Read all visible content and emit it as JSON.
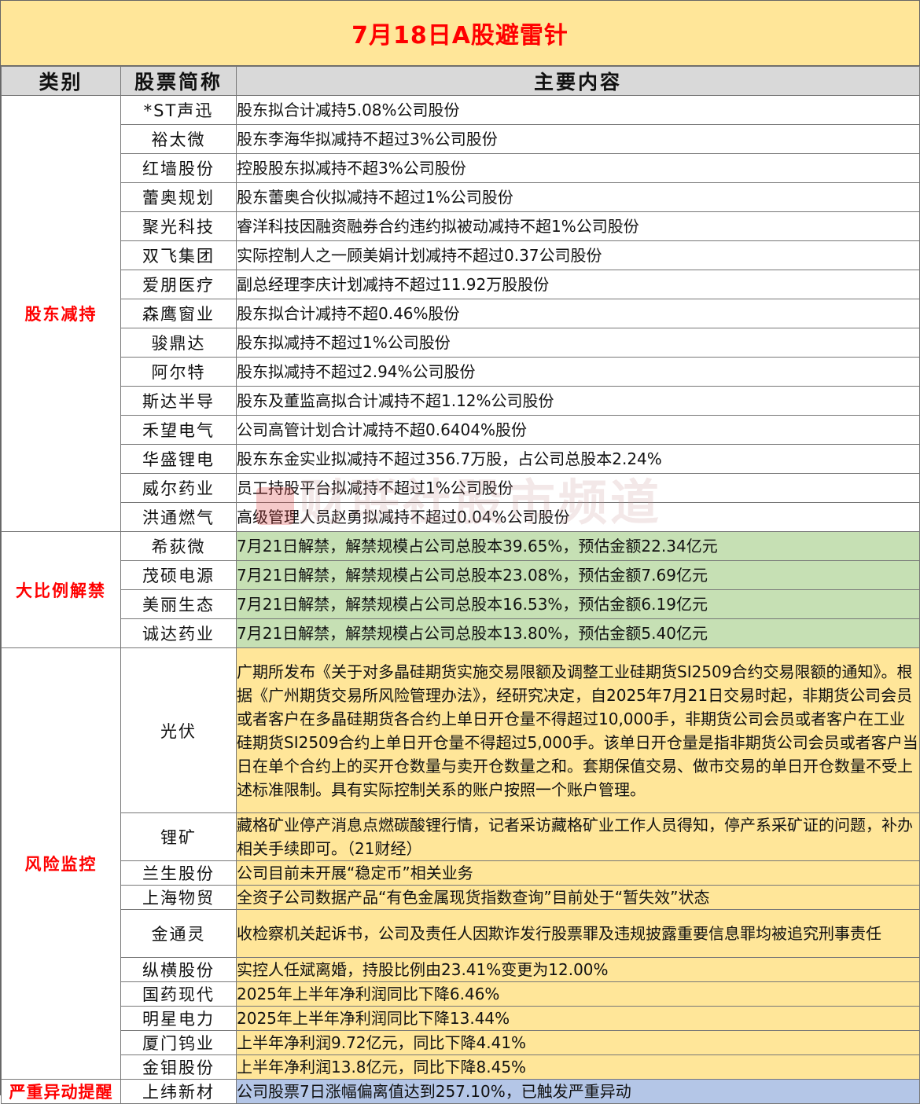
{
  "title": "7月18日A股避雷针",
  "headers": {
    "category": "类别",
    "stock": "股票简称",
    "content": "主要内容"
  },
  "sections": [
    {
      "category": "股东减持",
      "rows": [
        {
          "stock": "*ST声迅",
          "content": "股东拟合计减持5.08%公司股份"
        },
        {
          "stock": "裕太微",
          "content": "股东李海华拟减持不超过3%公司股份"
        },
        {
          "stock": "红墙股份",
          "content": "控股股东拟减持不超3%公司股份"
        },
        {
          "stock": "蕾奥规划",
          "content": "股东蕾奥合伙拟减持不超过1%公司股份"
        },
        {
          "stock": "聚光科技",
          "content": "睿洋科技因融资融券合约违约拟被动减持不超1%公司股份"
        },
        {
          "stock": "双飞集团",
          "content": "实际控制人之一顾美娟计划减持不超过0.37公司股份"
        },
        {
          "stock": "爱朋医疗",
          "content": "副总经理李庆计划减持不超过11.92万股股份"
        },
        {
          "stock": "森鹰窗业",
          "content": "股东拟合计减持不超0.46%股份"
        },
        {
          "stock": "骏鼎达",
          "content": "股东拟减持不超过1%公司股份"
        },
        {
          "stock": "阿尔特",
          "content": "股东拟减持不超过2.94%公司股份"
        },
        {
          "stock": "斯达半导",
          "content": "股东及董监高拟合计减持不超1.12%公司股份"
        },
        {
          "stock": "禾望电气",
          "content": "公司高管计划合计减持不超0.6404%股份"
        },
        {
          "stock": "华盛锂电",
          "content": "股东东金实业拟减持不超过356.7万股，占公司总股本2.24%"
        },
        {
          "stock": "威尔药业",
          "content": "员工持股平台拟减持不超过1%公司股份"
        },
        {
          "stock": "洪通燃气",
          "content": "高级管理人员赵勇拟减持不超过0.04%公司股份"
        }
      ]
    },
    {
      "category": "大比例解禁",
      "rows": [
        {
          "stock": "希荻微",
          "content": "7月21日解禁，解禁规模占公司总股本39.65%，预估金额22.34亿元"
        },
        {
          "stock": "茂硕电源",
          "content": "7月21日解禁，解禁规模占公司总股本23.08%，预估金额7.69亿元"
        },
        {
          "stock": "美丽生态",
          "content": "7月21日解禁，解禁规模占公司总股本16.53%，预估金额6.19亿元"
        },
        {
          "stock": "诚达药业",
          "content": "7月21日解禁，解禁规模占公司总股本13.80%，预估金额5.40亿元"
        }
      ]
    },
    {
      "category": "风险监控",
      "rows": [
        {
          "stock": "光伏",
          "content": "广期所发布《关于对多晶硅期货实施交易限额及调整工业硅期货SI2509合约交易限额的通知》。根据《广州期货交易所风险管理办法》，经研究决定，自2025年7月21日交易时起，非期货公司会员或者客户在多晶硅期货各合约上单日开仓量不得超过10,000手，非期货公司会员或者客户在工业硅期货SI2509合约上单日开仓量不得超过5,000手。该单日开仓量是指非期货公司会员或者客户当日在单个合约上的买开仓数量与卖开仓数量之和。套期保值交易、做市交易的单日开仓数量不受上述标准限制。具有实际控制关系的账户按照一个账户管理。"
        },
        {
          "stock": "锂矿",
          "content": "藏格矿业停产消息点燃碳酸锂行情，记者采访藏格矿业工作人员得知，停产系采矿证的问题，补办相关手续即可。（21财经）"
        },
        {
          "stock": "兰生股份",
          "content": "公司目前未开展“稳定币”相关业务"
        },
        {
          "stock": "上海物贸",
          "content": "全资子公司数据产品“有色金属现货指数查询”目前处于“暂失效”状态"
        },
        {
          "stock": "金通灵",
          "content": "收检察机关起诉书，公司及责任人因欺诈发行股票罪及违规披露重要信息罪均被追究刑事责任"
        },
        {
          "stock": "纵横股份",
          "content": "实控人任斌离婚，持股比例由23.41%变更为12.00%"
        },
        {
          "stock": "国药现代",
          "content": "2025年上半年净利润同比下降6.46%"
        },
        {
          "stock": "明星电力",
          "content": "2025年上半年净利润同比下降13.44%"
        },
        {
          "stock": "厦门钨业",
          "content": "上半年净利润9.72亿元，同比下降4.41%"
        },
        {
          "stock": "金钼股份",
          "content": "上半年净利润13.8亿元，同比下降8.45%"
        }
      ]
    },
    {
      "category": "严重异动提醒",
      "rows": [
        {
          "stock": "上纬新材",
          "content": "公司股票7日涨幅偏离值达到257.10%，已触发严重异动"
        }
      ]
    }
  ],
  "watermark": "财联社股市频道",
  "colors": {
    "title_bg": "#ffe699",
    "title_text": "#ff0000",
    "header_bg": "#d9d9d9",
    "category_text": "#ff0000",
    "unlock_bg": "#c6e0b4",
    "risk_bg": "#ffe699",
    "abnormal_bg": "#b4c6e7"
  }
}
